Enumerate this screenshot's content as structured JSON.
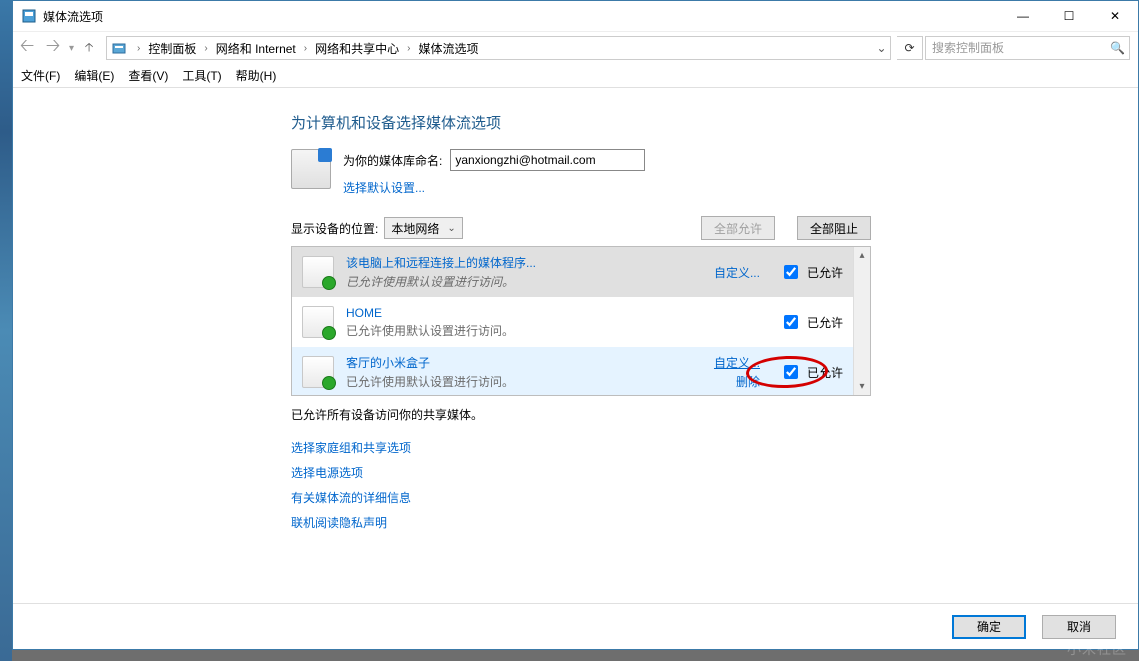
{
  "window": {
    "title": "媒体流选项"
  },
  "title_controls": {
    "min": "—",
    "max": "☐",
    "close": "✕"
  },
  "nav": {
    "breadcrumb": [
      "控制面板",
      "网络和 Internet",
      "网络和共享中心",
      "媒体流选项"
    ],
    "search_placeholder": "搜索控制面板"
  },
  "menu": {
    "file": "文件(F)",
    "edit": "编辑(E)",
    "view": "查看(V)",
    "tools": "工具(T)",
    "help": "帮助(H)"
  },
  "main": {
    "heading": "为计算机和设备选择媒体流选项",
    "library_name_label": "为你的媒体库命名:",
    "library_name_value": "yanxiongzhi@hotmail.com",
    "default_settings_link": "选择默认设置...",
    "position_label": "显示设备的位置:",
    "position_value": "本地网络",
    "allow_all": "全部允许",
    "block_all": "全部阻止",
    "status_line": "已允许所有设备访问你的共享媒体。",
    "allowed_label": "已允许",
    "customize": "自定义...",
    "customize_short": "自定义...",
    "remove": "删除"
  },
  "devices": [
    {
      "title": "该电脑上和远程连接上的媒体程序...",
      "sub": "已允许使用默认设置进行访问。",
      "italic": true,
      "link1": "自定义...",
      "checked": true,
      "selected": true
    },
    {
      "title": "HOME",
      "sub": "已允许使用默认设置进行访问。",
      "checked": true
    },
    {
      "title": "客厅的小米盒子",
      "sub": "已允许使用默认设置进行访问。",
      "link1": "自定义...",
      "link2": "删除",
      "checked": true,
      "hover": true
    }
  ],
  "bottom_links": {
    "l1": "选择家庭组和共享选项",
    "l2": "选择电源选项",
    "l3": "有关媒体流的详细信息",
    "l4": "联机阅读隐私声明"
  },
  "footer": {
    "ok": "确定",
    "cancel": "取消"
  },
  "watermark": "小米社区"
}
